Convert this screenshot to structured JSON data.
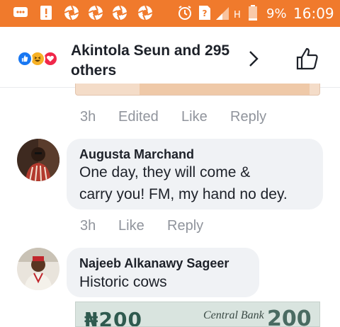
{
  "status_bar": {
    "battery_percent": "9%",
    "time": "16:09",
    "network": "H",
    "icons": [
      "message-icon",
      "alert-icon",
      "aperture-icon",
      "aperture-icon",
      "aperture-icon",
      "aperture-icon",
      "alarm-icon",
      "unknown-sim-icon",
      "signal-icon",
      "battery-icon"
    ]
  },
  "header": {
    "title": "Akintola Seun and 295 others",
    "reactions": [
      "like-reaction-icon",
      "haha-reaction-icon",
      "love-reaction-icon"
    ],
    "colors": {
      "like": "#1877f2",
      "haha": "#f7b125",
      "love": "#f0284a"
    }
  },
  "first_comment_meta": {
    "time": "3h",
    "edited": "Edited",
    "like": "Like",
    "reply": "Reply"
  },
  "comments": [
    {
      "author": "Augusta Marchand",
      "text_line1": "One day, they will come &",
      "text_line2": "carry you! FM, my hand no dey.",
      "time": "3h",
      "like": "Like",
      "reply": "Reply"
    },
    {
      "author": "Najeeb Alkanawy Sageer",
      "text": "Historic cows"
    }
  ],
  "attachment": {
    "value_left": "₦200",
    "bank_text": "Central Bank",
    "value_right": "200"
  }
}
